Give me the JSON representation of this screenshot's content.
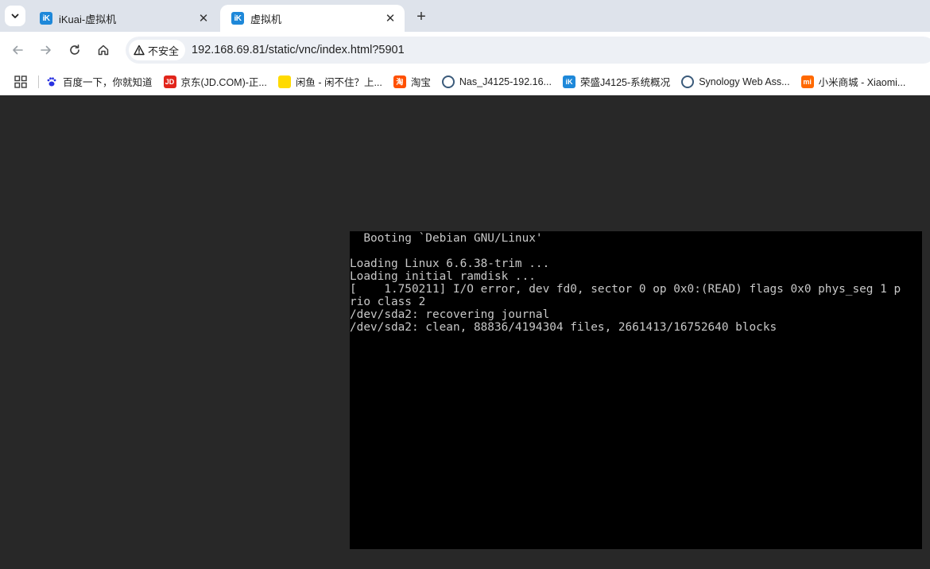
{
  "browser": {
    "tabs": [
      {
        "title": "iKuai-虚拟机",
        "favicon_text": "iK",
        "active": false
      },
      {
        "title": "虚拟机",
        "favicon_text": "iK",
        "active": true
      }
    ],
    "close_glyph": "✕",
    "new_tab_glyph": "+",
    "security_label": "不安全",
    "url": "192.168.69.81/static/vnc/index.html?5901",
    "bookmarks": [
      {
        "label": "百度一下，你就知道",
        "icon": "baidu-paw-icon",
        "color": "#2932e1",
        "icon_text": ""
      },
      {
        "label": "京东(JD.COM)-正...",
        "icon": "jd-icon",
        "color": "#e1251b",
        "icon_text": "JD"
      },
      {
        "label": "闲鱼 - 闲不住？上...",
        "icon": "xianyu-icon",
        "color": "#ffda00",
        "icon_text": ""
      },
      {
        "label": "淘宝",
        "icon": "taobao-icon",
        "color": "#ff5000",
        "icon_text": "淘"
      },
      {
        "label": "Nas_J4125-192.16...",
        "icon": "synology-icon",
        "color": "#3a5a7a",
        "icon_text": ""
      },
      {
        "label": "荣盛J4125-系统概况",
        "icon": "ikuai-icon",
        "color": "#1e88d9",
        "icon_text": "iK"
      },
      {
        "label": "Synology Web Ass...",
        "icon": "synology-icon",
        "color": "#3a5a7a",
        "icon_text": ""
      },
      {
        "label": "小米商城 - Xiaomi...",
        "icon": "mi-icon",
        "color": "#ff6900",
        "icon_text": "mi"
      }
    ]
  },
  "vnc": {
    "console_lines": [
      "  Booting `Debian GNU/Linux'",
      "",
      "Loading Linux 6.6.38-trim ...",
      "Loading initial ramdisk ...",
      "[    1.750211] I/O error, dev fd0, sector 0 op 0x0:(READ) flags 0x0 phys_seg 1 p",
      "rio class 2",
      "/dev/sda2: recovering journal",
      "/dev/sda2: clean, 88836/4194304 files, 2661413/16752640 blocks"
    ]
  }
}
